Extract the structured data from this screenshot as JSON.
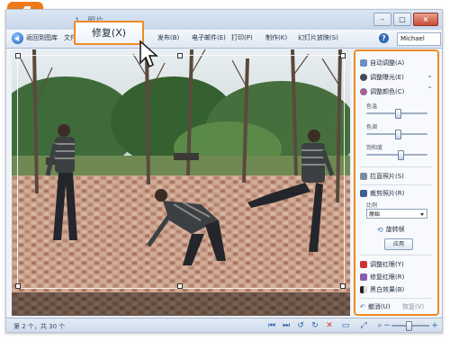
{
  "step_badge": "4",
  "title": "1 . 照片",
  "window_buttons": [
    "minimize-icon",
    "maximize-icon",
    "close-icon"
  ],
  "menubar": {
    "back_label": "返回到图库",
    "file_label": "文件",
    "items": [
      "发布(B)",
      "电子邮件(E)",
      "打印(P)",
      "制作(K)",
      "幻灯片放映(S)"
    ],
    "help_icon": "?",
    "user": "Michael"
  },
  "tooltip": "修复(X)",
  "panel": {
    "auto_adjust": "自动调整(A)",
    "exposure": "调整曝光(E)",
    "color": "调整颜色(C)",
    "color_sliders": [
      "色温",
      "色调",
      "饱和度"
    ],
    "straighten": "拉直照片(S)",
    "crop": "裁剪照片(R)",
    "ratio_label": "比例",
    "ratio_value": "原始",
    "rotate_frame": "旋转帧",
    "apply": "应用",
    "red_eye": "调整红眼(Y)",
    "undo": "修复红眼(R)",
    "black_white": "黑白效果(B)",
    "undo_btn": "撤消(U)",
    "revert_btn": "恢复(V)"
  },
  "status": {
    "position": "第 2 个，共 30 个"
  },
  "colors": {
    "accent_orange": "#f08a24",
    "toolbar_blue": "#dbe6f3",
    "delete_red": "#d23a2a"
  }
}
